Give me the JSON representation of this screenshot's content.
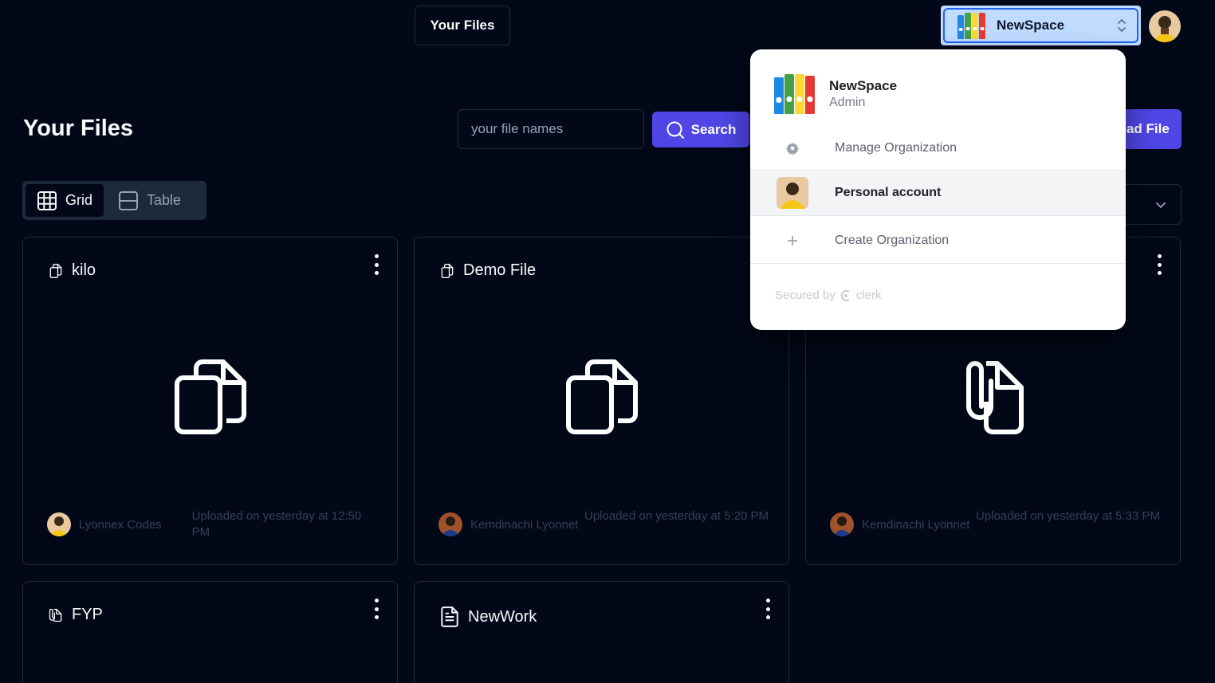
{
  "header": {
    "nav_label": "Your Files",
    "org_switcher": {
      "label": "NewSpace"
    }
  },
  "main": {
    "title": "Your Files",
    "search": {
      "placeholder": "your file names",
      "button_label": "Search"
    },
    "upload_label": "Upload File",
    "view_toggle": {
      "grid_label": "Grid",
      "table_label": "Table",
      "active": "Grid"
    }
  },
  "files": [
    {
      "name": "kilo",
      "type_icon": "copy-icon",
      "preview_icon": "copy-icon",
      "author": "Lyonnex Codes",
      "uploaded": "Uploaded on yesterday at 12:50 PM"
    },
    {
      "name": "Demo File",
      "type_icon": "copy-icon",
      "preview_icon": "copy-icon",
      "author": "Kemdinachi Lyonnet",
      "uploaded": "Uploaded on yesterday at 5:20 PM"
    },
    {
      "name": "",
      "type_icon": "paperclip-file-icon",
      "preview_icon": "paperclip-file-icon",
      "author": "Kemdinachi Lyonnet",
      "uploaded": "Uploaded on yesterday at 5:33 PM"
    },
    {
      "name": "FYP",
      "type_icon": "paperclip-file-icon"
    },
    {
      "name": "NewWork",
      "type_icon": "document-icon"
    }
  ],
  "org_dropdown": {
    "active_org": {
      "name": "NewSpace",
      "role": "Admin"
    },
    "manage_label": "Manage Organization",
    "personal_label": "Personal account",
    "create_label": "Create Organization",
    "footer": {
      "secured_by": "Secured by",
      "brand": "clerk"
    }
  },
  "colors": {
    "background": "#020817",
    "accent": "#4f46e5",
    "border": "#1e293b",
    "switcher_bg": "#bfdbfe"
  }
}
